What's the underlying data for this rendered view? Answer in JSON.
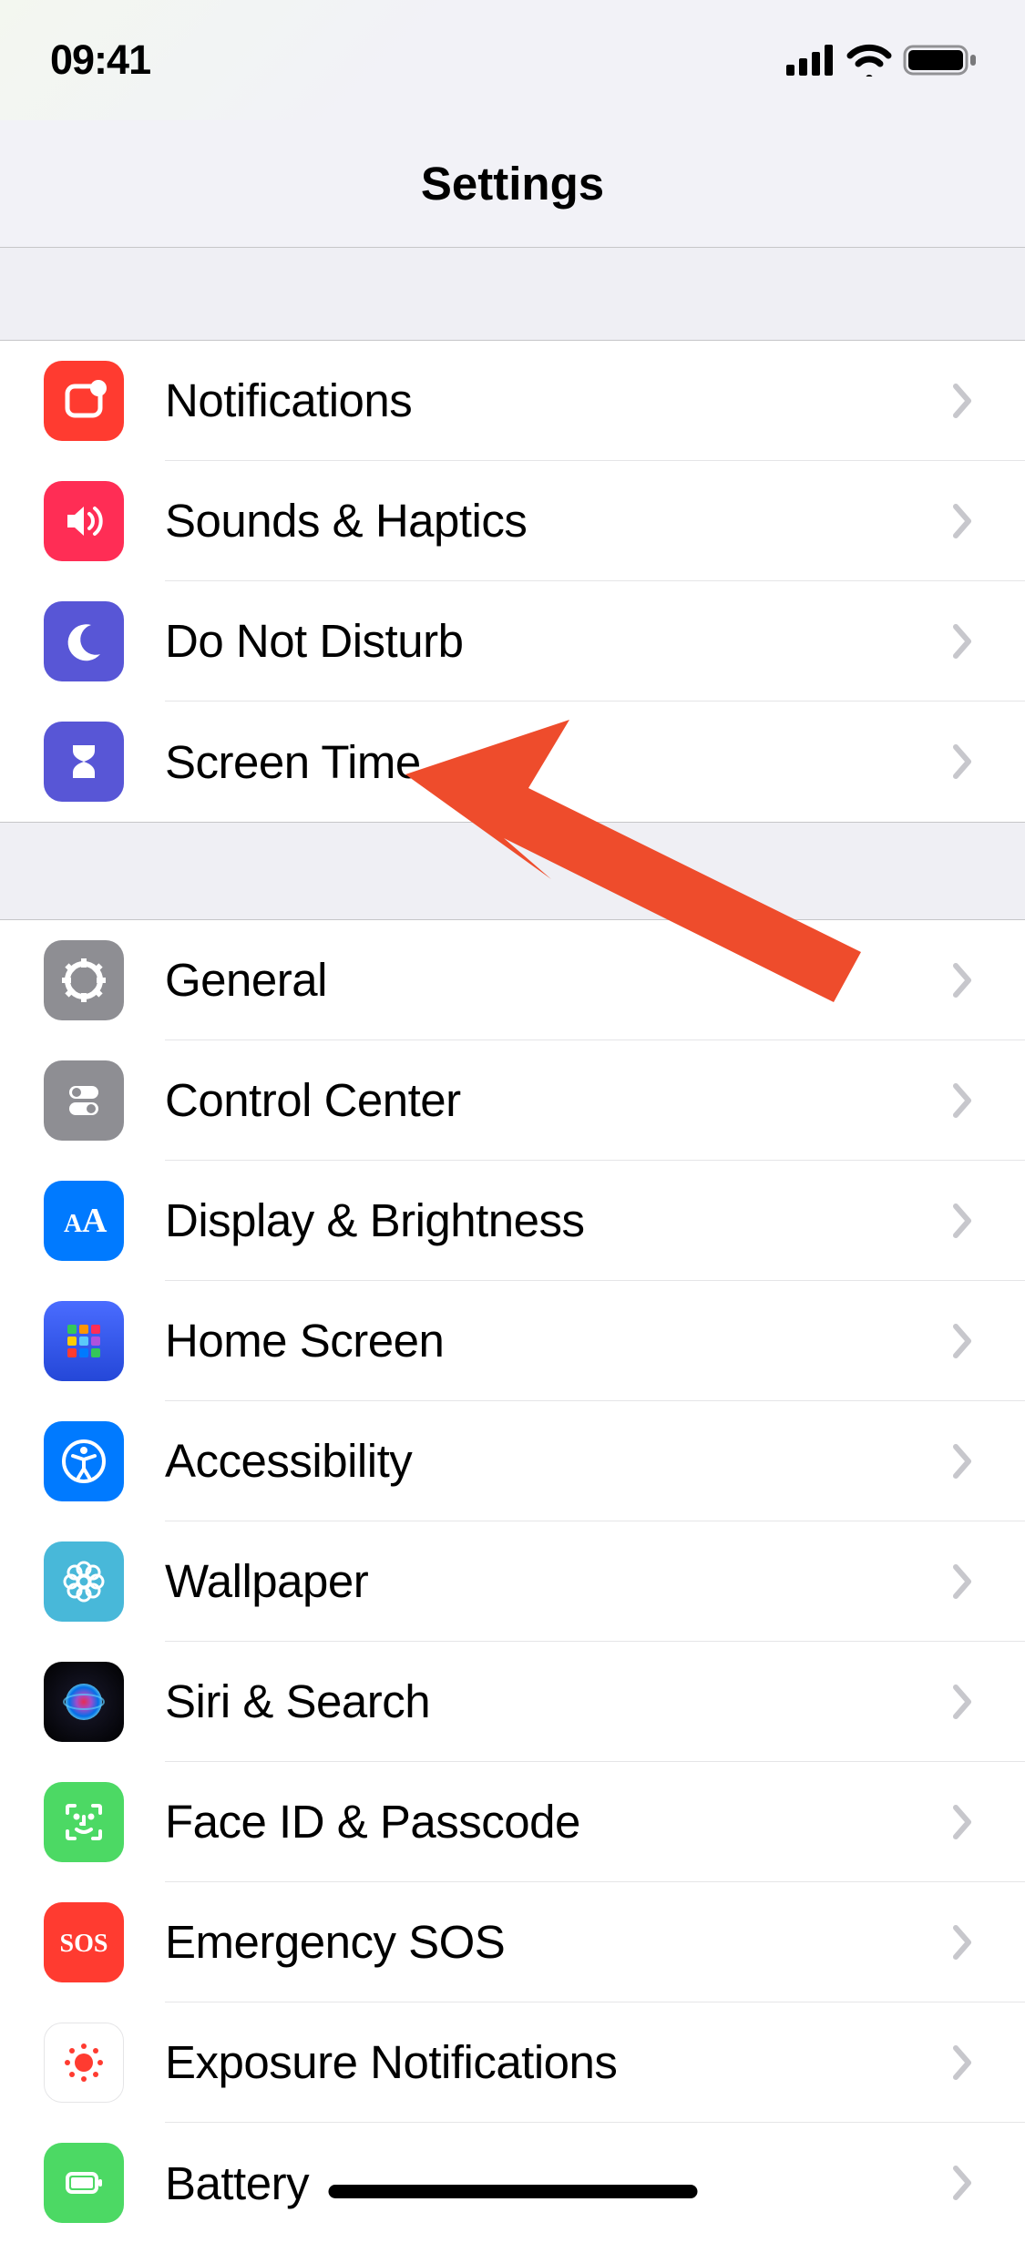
{
  "status": {
    "time": "09:41"
  },
  "nav": {
    "title": "Settings"
  },
  "groups": [
    {
      "items": [
        {
          "id": "notifications",
          "label": "Notifications",
          "icon": "notifications",
          "bg": "#ff3b30"
        },
        {
          "id": "sounds",
          "label": "Sounds & Haptics",
          "icon": "sounds",
          "bg": "#ff2d55"
        },
        {
          "id": "dnd",
          "label": "Do Not Disturb",
          "icon": "moon",
          "bg": "#5856d6"
        },
        {
          "id": "screentime",
          "label": "Screen Time",
          "icon": "hourglass",
          "bg": "#5856d6"
        }
      ]
    },
    {
      "items": [
        {
          "id": "general",
          "label": "General",
          "icon": "gear",
          "bg": "#8e8e93"
        },
        {
          "id": "controlcenter",
          "label": "Control Center",
          "icon": "switches",
          "bg": "#8e8e93"
        },
        {
          "id": "display",
          "label": "Display & Brightness",
          "icon": "aa",
          "bg": "#007aff"
        },
        {
          "id": "homescreen",
          "label": "Home Screen",
          "icon": "apps",
          "bg": "#3355cc"
        },
        {
          "id": "accessibility",
          "label": "Accessibility",
          "icon": "accessibility",
          "bg": "#007aff"
        },
        {
          "id": "wallpaper",
          "label": "Wallpaper",
          "icon": "flower",
          "bg": "#48b8d9"
        },
        {
          "id": "siri",
          "label": "Siri & Search",
          "icon": "siri",
          "bg": "#000000"
        },
        {
          "id": "faceid",
          "label": "Face ID & Passcode",
          "icon": "face",
          "bg": "#4cd964"
        },
        {
          "id": "sos",
          "label": "Emergency SOS",
          "icon": "sos",
          "bg": "#ff3b30"
        },
        {
          "id": "exposure",
          "label": "Exposure Notifications",
          "icon": "exposure",
          "bg": "#ffffff"
        },
        {
          "id": "battery",
          "label": "Battery",
          "icon": "battery",
          "bg": "#4cd964"
        }
      ]
    }
  ],
  "annotation": {
    "type": "arrow",
    "points_to": "screentime",
    "color": "#ee4c2c"
  }
}
